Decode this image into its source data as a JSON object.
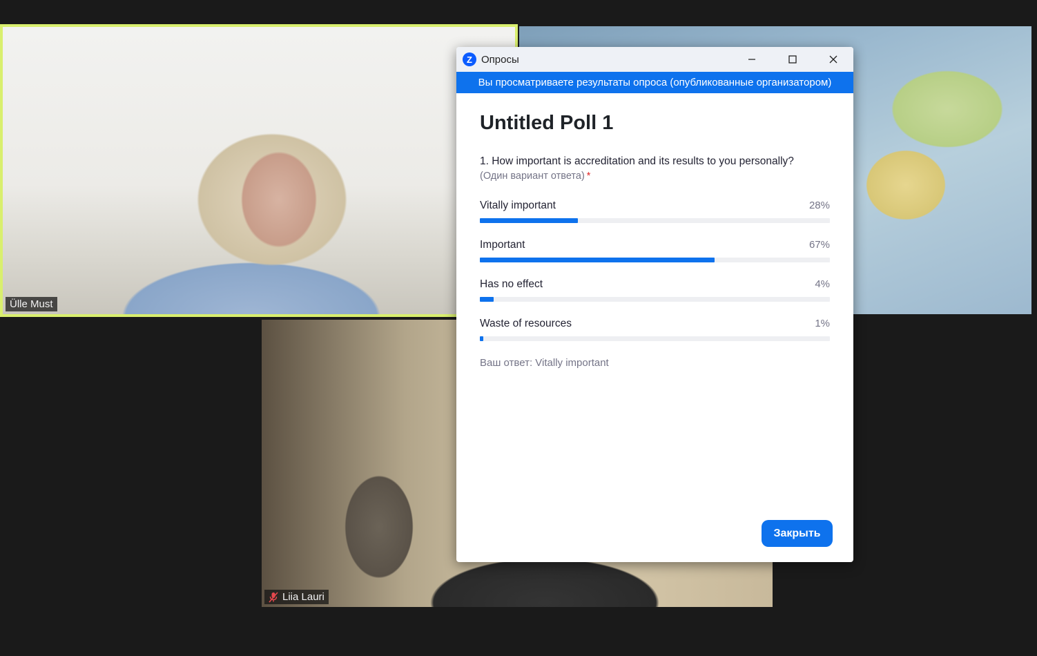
{
  "participants": [
    {
      "name": "Ülle Must",
      "muted": false
    },
    {
      "name": "Liia Lauri",
      "muted": true
    }
  ],
  "poll_window": {
    "title": "Опросы",
    "banner": "Вы просматриваете результаты опроса (опубликованные организатором)",
    "poll_title": "Untitled Poll 1",
    "question": "1. How important is accreditation and its results to you personally?",
    "hint": "(Один вариант ответа)",
    "required_mark": "*",
    "options": [
      {
        "label": "Vitally important",
        "percent_text": "28%",
        "percent": 28
      },
      {
        "label": "Important",
        "percent_text": "67%",
        "percent": 67
      },
      {
        "label": "Has no effect",
        "percent_text": "4%",
        "percent": 4
      },
      {
        "label": "Waste of resources",
        "percent_text": "1%",
        "percent": 1
      }
    ],
    "your_answer": "Ваш ответ: Vitally important",
    "close_label": "Закрыть",
    "accent_color": "#0e72ed"
  }
}
